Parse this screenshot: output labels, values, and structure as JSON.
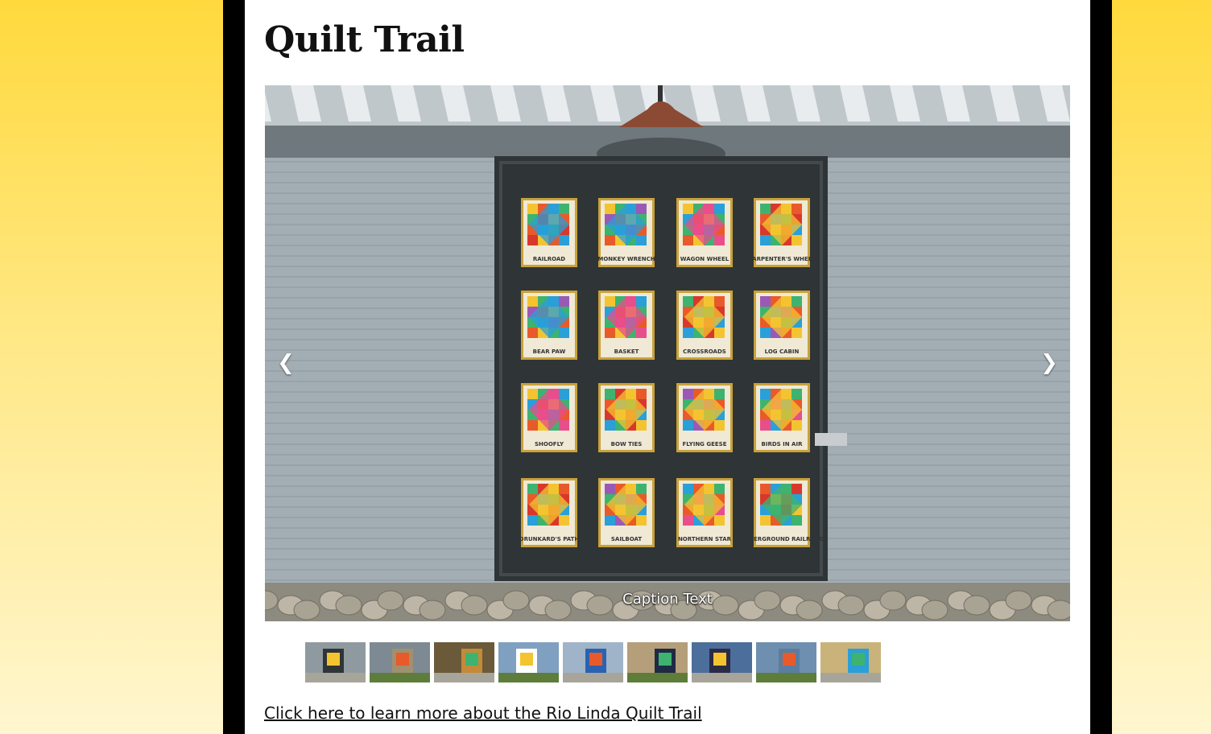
{
  "page": {
    "title": "Quilt Trail"
  },
  "slideshow": {
    "caption": "Caption Text",
    "prev_label": "❮",
    "next_label": "❯",
    "blocks": [
      [
        "RAILROAD",
        "MONKEY WRENCH",
        "WAGON WHEEL",
        "CARPENTER'S WHEEL"
      ],
      [
        "BEAR PAW",
        "BASKET",
        "CROSSROADS",
        "LOG CABIN"
      ],
      [
        "SHOOFLY",
        "BOW TIES",
        "FLYING GEESE",
        "BIRDS IN AIR"
      ],
      [
        "DRUNKARD'S PATH",
        "SAILBOAT",
        "NORTHERN STAR",
        "UNDERGROUND RAILROAD"
      ]
    ],
    "thumbnail_count": 9
  },
  "link": {
    "label": "Click here to learn more about the Rio Linda Quilt Trail"
  },
  "colors": {
    "page_bg_top": "#ffd93d",
    "frame": "#000000",
    "wall": "#9ca7ad",
    "door": "#2f3437"
  }
}
